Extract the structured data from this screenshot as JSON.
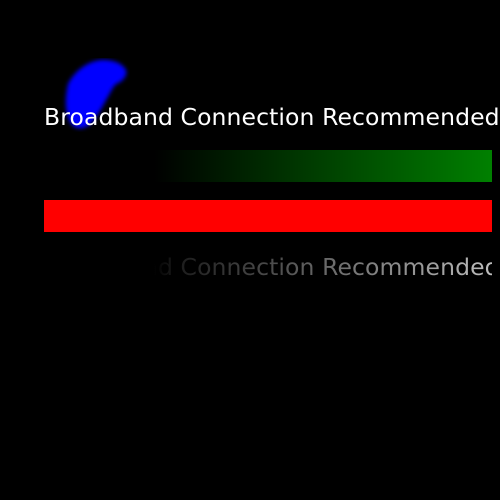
{
  "headline": {
    "text": "Broadband Connection Recommended",
    "color": "#ffffff"
  },
  "progress": {
    "gradient_bar_color": "#008000",
    "alert_bar_color": "#ff0000"
  },
  "ghost": {
    "text": "Broadband Connection Recommended"
  },
  "blob": {
    "icon": "blue-brush-blob",
    "color": "#0000ff"
  },
  "background_color": "#000000"
}
